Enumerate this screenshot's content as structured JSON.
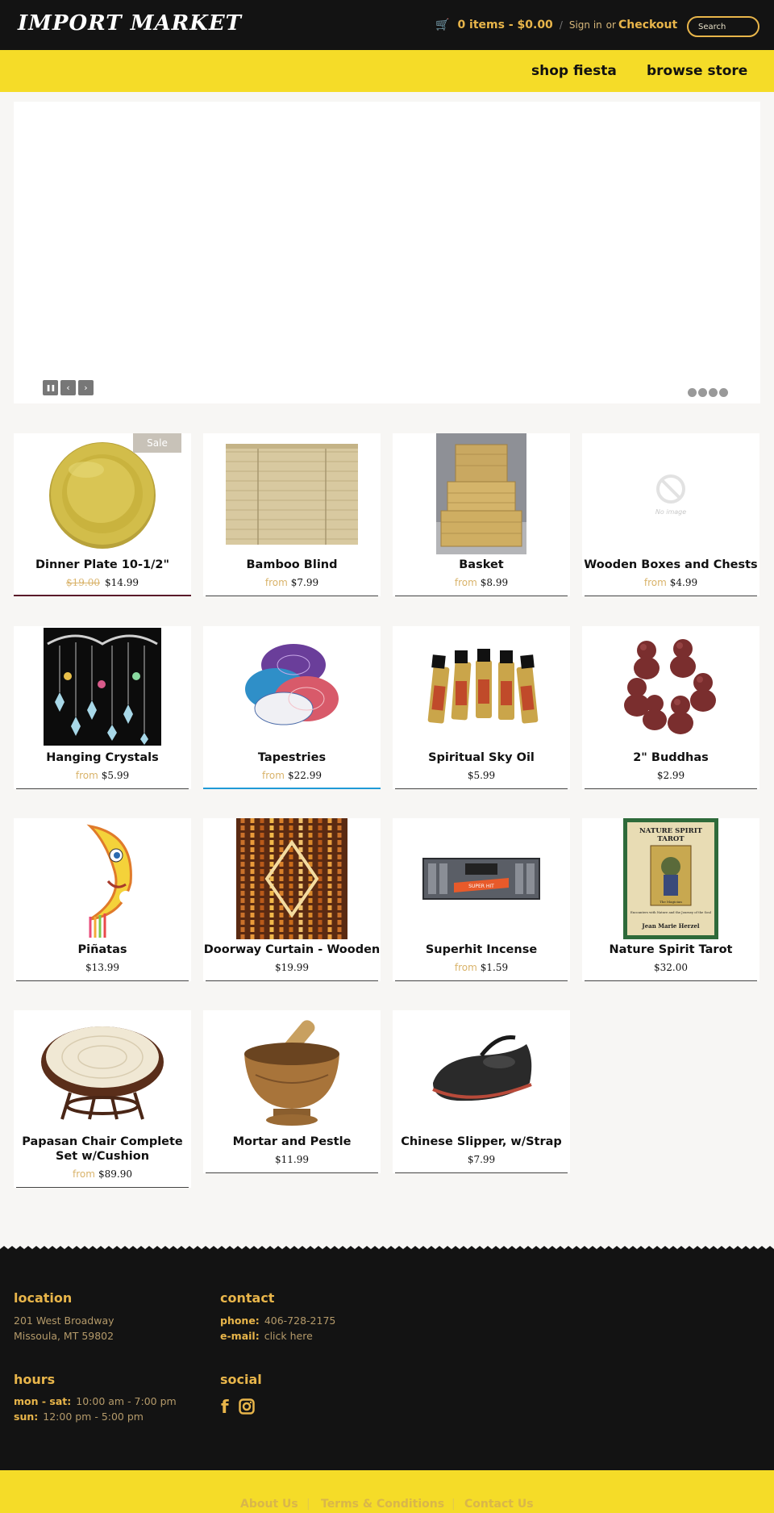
{
  "header": {
    "logo": "IMPORT MARKET",
    "cart_summary": "0 items - $0.00",
    "separator": "/",
    "sign_in": "Sign in",
    "or": "or",
    "checkout": "Checkout",
    "search_placeholder": "Search"
  },
  "nav": {
    "shop": "shop fiesta",
    "browse": "browse store"
  },
  "slider": {
    "slide_count": 4
  },
  "products": [
    {
      "title": "Dinner Plate 10-1/2\"",
      "sale_badge": "Sale",
      "was": "$19.00",
      "price": "$14.99"
    },
    {
      "title": "Bamboo Blind",
      "from": "from",
      "price": "$7.99"
    },
    {
      "title": "Basket",
      "from": "from",
      "price": "$8.99"
    },
    {
      "title": "Wooden Boxes and Chests",
      "from": "from",
      "price": "$4.99",
      "no_image_text": "No image"
    },
    {
      "title": "Hanging Crystals",
      "from": "from",
      "price": "$5.99"
    },
    {
      "title": "Tapestries",
      "from": "from",
      "price": "$22.99"
    },
    {
      "title": "Spiritual Sky Oil",
      "price": "$5.99"
    },
    {
      "title": "2\" Buddhas",
      "price": "$2.99"
    },
    {
      "title": "Piñatas",
      "price": "$13.99"
    },
    {
      "title": "Doorway Curtain - Wooden",
      "price": "$19.99"
    },
    {
      "title": "Superhit Incense",
      "from": "from",
      "price": "$1.59",
      "label": "SUPER HIT"
    },
    {
      "title": "Nature Spirit Tarot",
      "price": "$32.00",
      "cover_title_1": "NATURE SPIRIT",
      "cover_title_2": "TAROT",
      "cover_subtitle": "Encounters with Nature and the Journey of the Soul",
      "cover_author": "Jean Marie Herzel",
      "cover_card": "The Magician"
    },
    {
      "title": "Papasan Chair Complete Set w/Cushion",
      "from": "from",
      "price": "$89.90"
    },
    {
      "title": "Mortar and Pestle",
      "price": "$11.99"
    },
    {
      "title": "Chinese Slipper, w/Strap",
      "price": "$7.99"
    }
  ],
  "footer": {
    "location_heading": "location",
    "address_1": "201 West Broadway",
    "address_2": "Missoula, MT 59802",
    "contact_heading": "contact",
    "phone_label": "phone:",
    "phone": "406-728-2175",
    "email_label": "e-mail:",
    "email": "click here",
    "hours_heading": "hours",
    "hours_1_label": "mon - sat:",
    "hours_1": "10:00 am - 7:00 pm",
    "hours_2_label": "sun:",
    "hours_2": "12:00 pm - 5:00 pm",
    "social_heading": "social",
    "social_icons": [
      "facebook-icon",
      "instagram-icon"
    ]
  },
  "bottom_links": {
    "about": "About Us",
    "terms": "Terms & Conditions",
    "contact": "Contact Us",
    "separator": "|"
  },
  "colors": {
    "accent_yellow": "#f5dc28",
    "accent_gold": "#e8b54a",
    "dark": "#131313",
    "page_bg": "#f7f6f4"
  }
}
